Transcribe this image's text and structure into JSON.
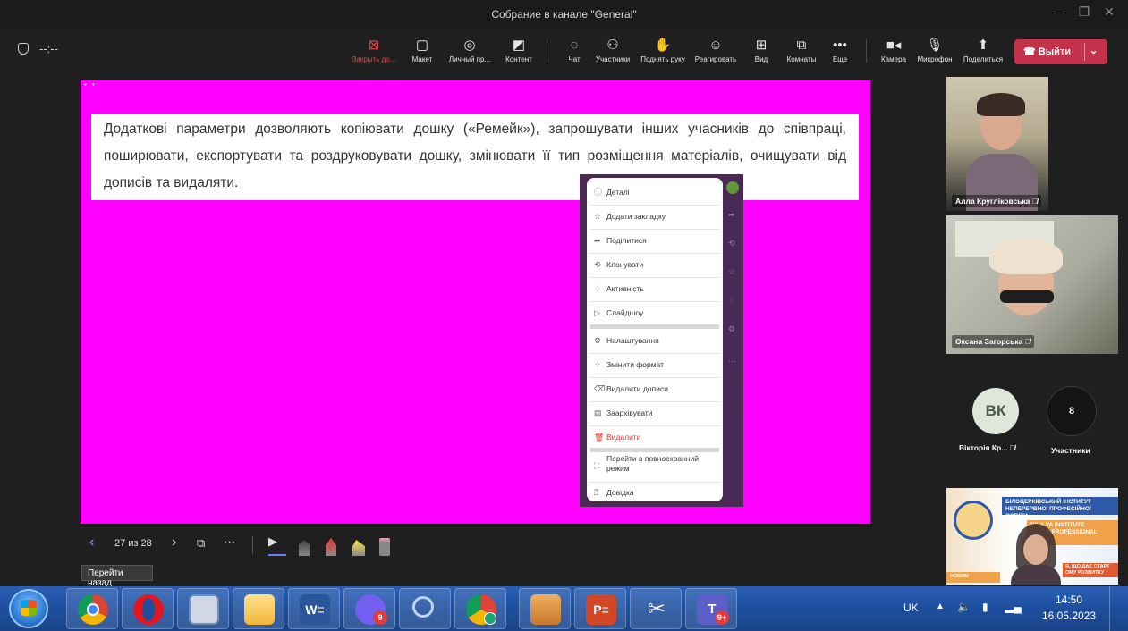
{
  "window": {
    "title": "Собрание в канале \"General\""
  },
  "toolbar": {
    "timer": "--:--",
    "buttons": [
      {
        "label": "Закрыть до...",
        "icon": "close-box-icon"
      },
      {
        "label": "Макет",
        "icon": "layout-icon"
      },
      {
        "label": "Личный пр...",
        "icon": "eye-icon"
      },
      {
        "label": "Контент",
        "icon": "content-icon"
      },
      {
        "label": "Чат",
        "icon": "chat-icon"
      },
      {
        "label": "Участники",
        "icon": "people-icon"
      },
      {
        "label": "Поднять руку",
        "icon": "hand-icon"
      },
      {
        "label": "Реагировать",
        "icon": "smile-icon"
      },
      {
        "label": "Вид",
        "icon": "grid-icon"
      },
      {
        "label": "Комнаты",
        "icon": "rooms-icon"
      },
      {
        "label": "Еще",
        "icon": "more-icon"
      },
      {
        "label": "Камера",
        "icon": "camera-icon"
      },
      {
        "label": "Микрофон",
        "icon": "mic-icon"
      },
      {
        "label": "Поделиться",
        "icon": "share-icon"
      }
    ],
    "leave_label": "Выйти",
    "accent_red": "#c4314b"
  },
  "content": {
    "paragraph": "Додаткові параметри дозволяють копіювати дошку («Ремейк»), запрошувати інших учасників до співпраці, поширювати, експортувати та роздруковувати дошку, змінювати її тип розміщення матеріалів, очищувати від дописів та видаляти.",
    "background_color": "#ff00ff",
    "menu": {
      "items": [
        {
          "label": "Деталі",
          "icon": "info-icon"
        },
        {
          "label": "Додати закладку",
          "icon": "star-icon"
        },
        {
          "label": "Поділитися",
          "icon": "share-arrow-icon"
        },
        {
          "label": "Клонувати",
          "icon": "clone-icon"
        },
        {
          "label": "Активність",
          "icon": "bell-icon"
        },
        {
          "label": "Слайдшоу",
          "icon": "play-icon"
        },
        {
          "label": "Налаштування",
          "icon": "settings-icon"
        },
        {
          "label": "Змінити формат",
          "icon": "format-icon"
        },
        {
          "label": "Видалити дописи",
          "icon": "eraser-icon"
        },
        {
          "label": "Заархівувати",
          "icon": "archive-icon"
        },
        {
          "label": "Видалити",
          "icon": "trash-icon"
        },
        {
          "label": "Перейти в повноекранний режим",
          "icon": "fullscreen-icon"
        },
        {
          "label": "Довідка",
          "icon": "help-icon"
        }
      ]
    }
  },
  "slides": {
    "counter": "27 из 28",
    "tooltip": "Перейти назад"
  },
  "participants": {
    "videos": [
      {
        "name": "Алла Кругліковська"
      },
      {
        "name": "Оксана Загорська"
      }
    ],
    "avatar_initials": "ВК",
    "avatar_name": "Вікторія Кр...",
    "others_count": "8",
    "others_label": "Участники"
  },
  "promo": {
    "line1": "БІЛОЦЕРКІВСЬКИЙ ІНСТИТУТ",
    "line2": "НЕПЕРЕРВНОЇ ПРОФЕСІЙНОЇ ОСВІТИ",
    "line3": "BILA       VA INSTITUTE",
    "line4": "OF C      S PROFESSIONAL",
    "line5": "EDU",
    "line6": "Я, ЩО ДАЄ СТАРТ",
    "line7": "ОМУ РОЗВИТКУ",
    "line8": "НОВИМ"
  },
  "taskbar": {
    "apps": [
      {
        "name": "chrome",
        "icon": "chrome-icon",
        "color": "#e8453c"
      },
      {
        "name": "opera",
        "icon": "opera-icon",
        "color": "#e0171f"
      },
      {
        "name": "calculator",
        "icon": "calculator-icon",
        "color": "#6b8fb8"
      },
      {
        "name": "explorer",
        "icon": "folder-icon",
        "color": "#f2c14e"
      },
      {
        "name": "word",
        "icon": "word-icon",
        "color": "#2b579a"
      },
      {
        "name": "viber",
        "icon": "viber-icon",
        "color": "#7360f2",
        "badge": "9"
      },
      {
        "name": "search",
        "icon": "magnifier-icon",
        "color": "#3a7bc8"
      },
      {
        "name": "chrome-profile",
        "icon": "chrome-profile-icon",
        "color": "#e8453c"
      },
      {
        "name": "archive",
        "icon": "archiver-icon",
        "color": "#d9822b"
      },
      {
        "name": "powerpoint",
        "icon": "powerpoint-icon",
        "color": "#d24726"
      },
      {
        "name": "snipping",
        "icon": "scissors-icon",
        "color": "#c04040"
      },
      {
        "name": "teams",
        "icon": "teams-icon",
        "color": "#5b5fc7",
        "badge": "9+"
      }
    ],
    "lang": "UK",
    "time": "14:50",
    "date": "16.05.2023"
  }
}
